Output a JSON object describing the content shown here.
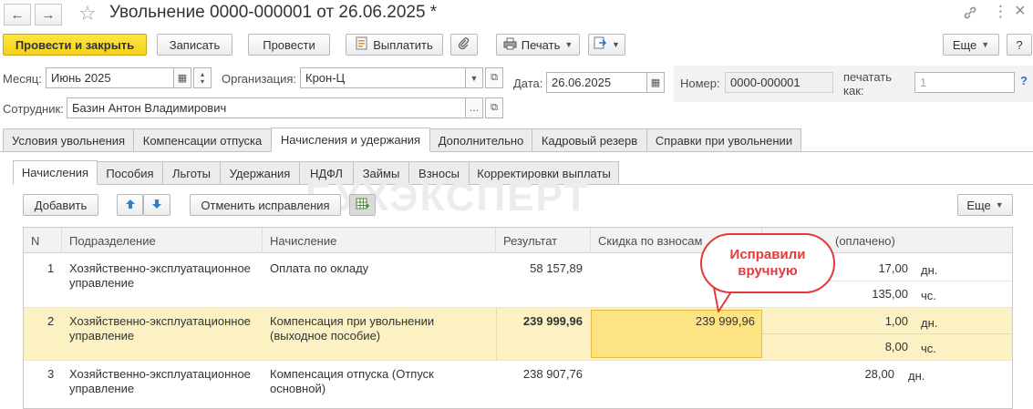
{
  "window": {
    "title": "Увольнение 0000-000001 от 26.06.2025 *",
    "back_icon": "←",
    "forward_icon": "→",
    "star_icon": "☆",
    "link_icon": "🔗",
    "menu_icon": "⋮",
    "close_icon": "×"
  },
  "toolbar": {
    "post_and_close": "Провести и закрыть",
    "save": "Записать",
    "post": "Провести",
    "pay": "Выплатить",
    "print": "Печать",
    "more": "Еще",
    "help": "?"
  },
  "fields": {
    "month_label": "Месяц:",
    "month_value": "Июнь 2025",
    "org_label": "Организация:",
    "org_value": "Крон-Ц",
    "date_label": "Дата:",
    "date_value": "26.06.2025",
    "number_label": "Номер:",
    "number_value": "0000-000001",
    "print_as_label_1": "печатать",
    "print_as_label_2": "как:",
    "print_as_value": "1",
    "print_as_help": "?",
    "employee_label": "Сотрудник:",
    "employee_value": "Базин Антон Владимирович"
  },
  "main_tabs": [
    "Условия увольнения",
    "Компенсации отпуска",
    "Начисления и удержания",
    "Дополнительно",
    "Кадровый резерв",
    "Справки при увольнении"
  ],
  "sub_tabs": [
    "Начисления",
    "Пособия",
    "Льготы",
    "Удержания",
    "НДФЛ",
    "Займы",
    "Взносы",
    "Корректировки выплаты"
  ],
  "table_toolbar": {
    "add": "Добавить",
    "cancel_corrections": "Отменить исправления",
    "more": "Еще"
  },
  "watermark": "БУХЭКСПЕРТ",
  "table": {
    "columns": [
      "N",
      "Подразделение",
      "Начисление",
      "Результат",
      "Скидка по взносам",
      "(оплачено)"
    ],
    "rows": [
      {
        "n": "1",
        "dept_1": "Хозяйственно-эксплуатационное",
        "dept_2": "управление",
        "accrual_1": "Оплата по окладу",
        "accrual_2": "",
        "result": "58 157,89",
        "discount": "",
        "paid_1": "17,00",
        "unit_1": "дн.",
        "paid_2": "135,00",
        "unit_2": "чс."
      },
      {
        "n": "2",
        "dept_1": "Хозяйственно-эксплуатационное",
        "dept_2": "управление",
        "accrual_1": "Компенсация при увольнении",
        "accrual_2": "(выходное пособие)",
        "result": "239 999,96",
        "discount": "239 999,96",
        "paid_1": "1,00",
        "unit_1": "дн.",
        "paid_2": "8,00",
        "unit_2": "чс."
      },
      {
        "n": "3",
        "dept_1": "Хозяйственно-эксплуатационное",
        "dept_2": "управление",
        "accrual_1": "Компенсация отпуска (Отпуск",
        "accrual_2": "основной)",
        "result": "238 907,76",
        "discount": "",
        "paid_1": "28,00",
        "unit_1": "дн.",
        "paid_2": "",
        "unit_2": ""
      }
    ]
  },
  "callout": {
    "line1": "Исправили",
    "line2": "вручную"
  }
}
